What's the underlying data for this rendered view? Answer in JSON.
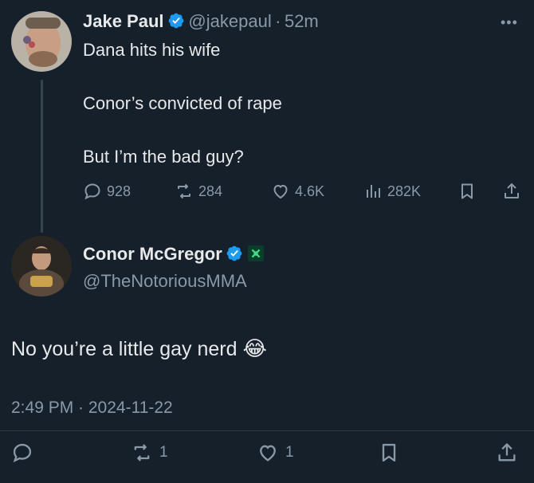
{
  "tweet1": {
    "author_name": "Jake Paul",
    "author_handle": "@jakepaul",
    "separator": "·",
    "time_ago": "52m",
    "lines": [
      "Dana hits his wife",
      "Conor’s convicted of rape",
      "But I’m the bad guy?"
    ],
    "replies": "928",
    "retweets": "284",
    "likes": "4.6K",
    "views": "282K"
  },
  "tweet2": {
    "author_name": "Conor McGregor",
    "author_handle": "@TheNotoriousMMA",
    "text": "No you’re a little gay nerd",
    "emoji": "😂",
    "timestamp": "2:49 PM · 2024-11-22",
    "retweets": "1",
    "likes": "1"
  },
  "colors": {
    "background": "#15202b",
    "verified": "#1d9bf0",
    "text_secondary": "#8b98a5",
    "affiliate_badge": "#0b3d2b"
  },
  "icons": [
    "more-icon",
    "verified-icon",
    "reply-icon",
    "retweet-icon",
    "like-icon",
    "views-icon",
    "bookmark-icon",
    "share-icon",
    "affiliate-badge-icon",
    "laughing-emoji-icon"
  ]
}
